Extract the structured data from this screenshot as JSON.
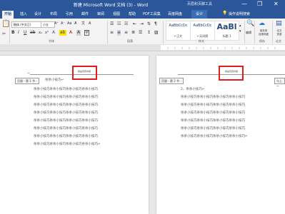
{
  "window": {
    "title": "新建 Microsoft Word 文档 (3) - Word",
    "context_label": "页眉和页脚工具",
    "controls": [
      "—",
      "❐",
      "✕"
    ]
  },
  "tabs": [
    "开始",
    "插入",
    "设计",
    "布局",
    "引用",
    "邮件",
    "审阅",
    "视图",
    "帮助",
    "PDF工具集",
    "百度网盘",
    "设计"
  ],
  "tell_me": "操作说明搜索",
  "ribbon": {
    "font_name": "楷体 (中文正)",
    "font_size": "小五",
    "group_labels": {
      "font": "字体",
      "paragraph": "段落",
      "styles": "样式",
      "right1": "编辑",
      "right2": "保存",
      "right3": "论文"
    },
    "styles": [
      {
        "sample": "AaBbCcDc",
        "name": "↵正文"
      },
      {
        "sample": "AaBbCcDc",
        "name": "↵无间隔"
      },
      {
        "sample": "AaBl",
        "name": "标题 1"
      }
    ],
    "edit_label": "编辑",
    "save_label": "保存到\n百度网盘",
    "check_label": "论文\n查重"
  },
  "pages": [
    {
      "header_tag": "页眉 - 第 1 节 -",
      "header_text": "我是页眉内容",
      "body_first": "杀杀小技巧↵",
      "body_lines": [
        "杀杀小技巧杀杀小技巧杀杀小技巧杀杀小技巧",
        "杀杀小技巧杀杀小技巧杀杀小技巧杀杀小技巧",
        "杀杀小技巧杀杀小技巧杀杀小技巧杀杀小技巧",
        "杀杀小技巧杀杀小技巧杀杀小技巧杀杀小技巧",
        "杀杀小技巧杀杀小技巧杀杀小技巧杀杀小技巧",
        "杀杀小技巧杀杀小技巧杀杀小技巧杀杀小技巧",
        "杀杀小技巧杀杀小技巧杀杀小技巧杀杀小技巧",
        "杀杀小技巧杀杀小技巧杀杀小技巧杀杀小技巧↵"
      ]
    },
    {
      "header_tag": "页眉 - 第 2 节 -",
      "header_right_tag": "与上一",
      "header_text": "我是页眉内容",
      "body_first": "2、杀杀小技巧↵",
      "body_lines": [
        "杀杀小技巧杀杀小技巧杀杀小技巧杀杀小技巧",
        "杀杀小技巧杀杀小技巧杀杀小技巧杀杀小技巧",
        "杀杀小技巧杀杀小技巧杀杀小技巧杀杀小技巧",
        "杀杀小技巧杀杀小技巧杀杀小技巧杀杀小技巧",
        "杀杀小技巧杀杀小技巧杀杀小技巧杀杀小技巧",
        "杀杀小技巧杀杀小技巧杀杀小技巧杀杀小技巧↵"
      ]
    }
  ],
  "colors": {
    "brand": "#2b579a",
    "highlight": "#e01e1e"
  }
}
